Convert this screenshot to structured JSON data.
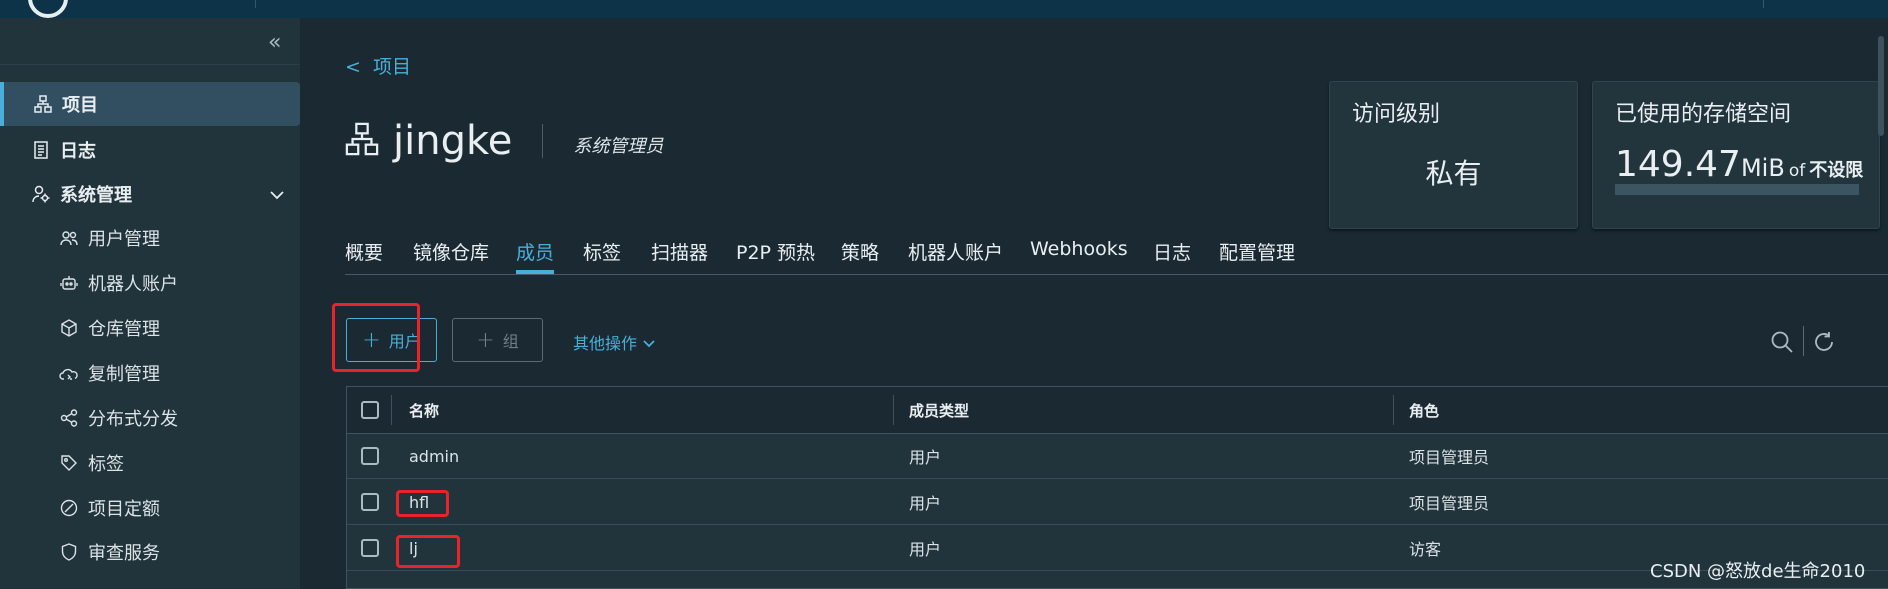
{
  "sidebar": {
    "items": [
      {
        "label": "项目",
        "icon": "project-icon"
      },
      {
        "label": "日志",
        "icon": "log-icon"
      },
      {
        "label": "系统管理",
        "icon": "admin-icon"
      },
      {
        "label": "用户管理",
        "icon": "users-icon"
      },
      {
        "label": "机器人账户",
        "icon": "robot-icon"
      },
      {
        "label": "仓库管理",
        "icon": "cube-icon"
      },
      {
        "label": "复制管理",
        "icon": "cloud-sync-icon"
      },
      {
        "label": "分布式分发",
        "icon": "share-icon"
      },
      {
        "label": "标签",
        "icon": "tag-icon"
      },
      {
        "label": "项目定额",
        "icon": "quota-icon"
      },
      {
        "label": "审查服务",
        "icon": "shield-icon"
      }
    ]
  },
  "breadcrumb": {
    "arrow": "<",
    "label": "项目"
  },
  "project": {
    "name": "jingke",
    "role": "系统管理员"
  },
  "cards": {
    "access": {
      "title": "访问级别",
      "value": "私有"
    },
    "storage": {
      "title": "已使用的存储空间",
      "number": "149.47",
      "unit": "MiB",
      "of": "of",
      "limit": "不设限"
    }
  },
  "tabs": [
    "概要",
    "镜像仓库",
    "成员",
    "标签",
    "扫描器",
    "P2P 预热",
    "策略",
    "机器人账户",
    "Webhooks",
    "日志",
    "配置管理"
  ],
  "actions": {
    "add_user": "用户",
    "add_group": "组",
    "more": "其他操作"
  },
  "table": {
    "headers": [
      "名称",
      "成员类型",
      "角色"
    ],
    "rows": [
      [
        "admin",
        "用户",
        "项目管理员"
      ],
      [
        "hfl",
        "用户",
        "项目管理员"
      ],
      [
        "lj",
        "用户",
        "访客"
      ]
    ]
  },
  "watermark": "CSDN @怒放de生命2010",
  "colors": {
    "accent": "#49afd9",
    "background": "#1b2a32",
    "sidebar": "#21333b",
    "topbar": "#0c3347",
    "highlight": "#e8232a"
  }
}
